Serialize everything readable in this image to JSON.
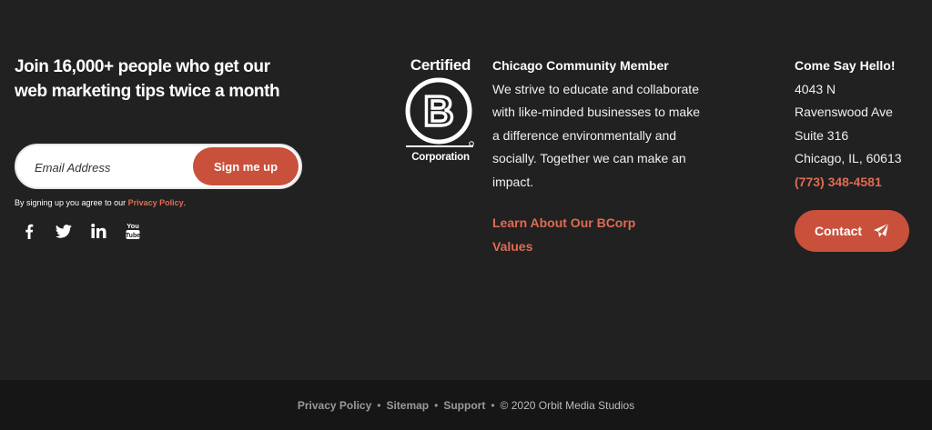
{
  "newsletter": {
    "headline": "Join 16,000+ people who get our web marketing tips twice a month",
    "email_placeholder": "Email Address",
    "submit_label": "Sign me up",
    "agree_prefix": "By signing up you agree to our ",
    "agree_link": "Privacy Policy",
    "agree_suffix": "."
  },
  "social": {
    "icons": [
      "facebook-icon",
      "twitter-icon",
      "linkedin-icon",
      "youtube-icon"
    ]
  },
  "bcorp": {
    "certified": "Certified",
    "letter": "B",
    "corporation": "Corporation",
    "title": "Chicago Community Member",
    "description": "We strive to educate and collaborate with like-minded businesses to make a difference environmentally and socially. Together we can make an impact.",
    "learn_link": "Learn About Our BCorp Values"
  },
  "contact": {
    "title": "Come Say Hello!",
    "address_line1": "4043 N",
    "address_line2": "Ravenswood Ave",
    "address_line3": "Suite 316",
    "address_line4": "Chicago, IL, 60613",
    "phone": "(773) 348-4581",
    "button_label": "Contact"
  },
  "footer": {
    "privacy": "Privacy Policy",
    "sitemap": "Sitemap",
    "support": "Support",
    "bullet": "•",
    "copyright": "© 2020 Orbit Media Studios"
  },
  "colors": {
    "background": "#212121",
    "bottom_bar": "#161616",
    "accent": "#c9503b",
    "link": "#e06b52"
  }
}
